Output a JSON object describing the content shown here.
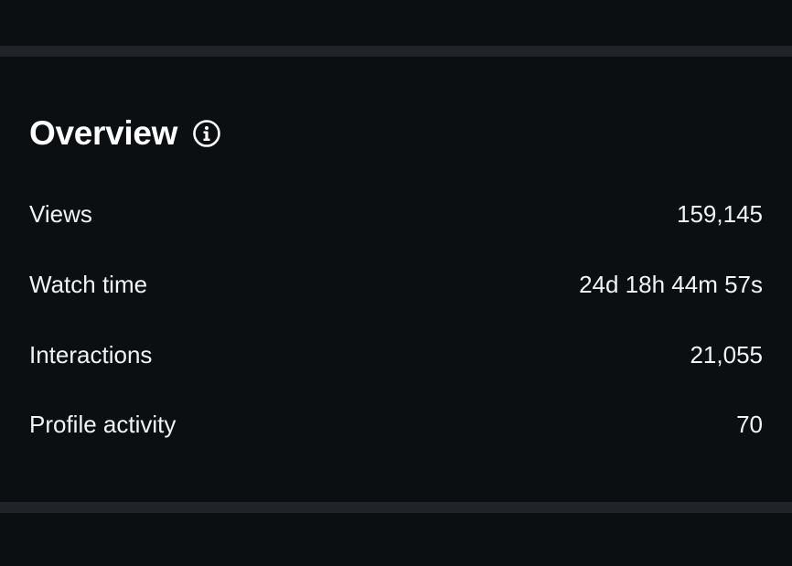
{
  "overview": {
    "title": "Overview",
    "info_icon": "info-icon",
    "metrics": [
      {
        "label": "Views",
        "value": "159,145"
      },
      {
        "label": "Watch time",
        "value": "24d 18h 44m 57s"
      },
      {
        "label": "Interactions",
        "value": "21,055"
      },
      {
        "label": "Profile activity",
        "value": "70"
      }
    ]
  },
  "colors": {
    "background": "#0c0f12",
    "divider": "#202328",
    "text": "#f2f3f5"
  }
}
